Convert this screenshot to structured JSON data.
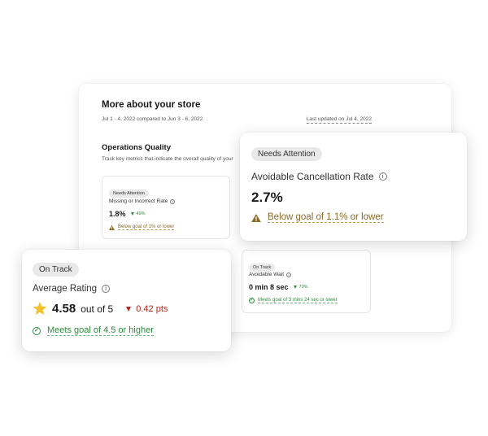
{
  "store": {
    "title": "More about your store",
    "date_range": "Jul 1 - 4, 2022 compared to Jun 3 - 6, 2022",
    "last_updated": "Last updated on Jul 4, 2022"
  },
  "operations": {
    "title": "Operations Quality",
    "description": "Track key metrics that indicate the overall quality of your"
  },
  "metrics": {
    "missing_incorrect": {
      "status": "Needs Attention",
      "label": "Missing or Incorrect Rate",
      "value": "1.8%",
      "delta": "49%",
      "goal": "Below goal of 1% or lower"
    },
    "avoidable_wait": {
      "status": "On Track",
      "label": "Avoidable Wait",
      "value": "0 min 8 sec",
      "delta": "70%",
      "goal": "Meets goal of 3 mins 24 sec or lower"
    },
    "cancellation": {
      "status": "Needs Attention",
      "label": "Avoidable Cancellation Rate",
      "value": "2.7%",
      "goal": "Below goal of 1.1% or lower"
    },
    "rating": {
      "status": "On Track",
      "label": "Average Rating",
      "value": "4.58",
      "suffix": "out of 5",
      "delta": "0.42 pts",
      "goal": "Meets goal of 4.5 or higher"
    }
  },
  "colors": {
    "warning": "#8a6a28",
    "success": "#2f8a3d",
    "negative": "#b5241a",
    "star": "#f2c12e"
  },
  "icons": {
    "info": "i",
    "check": "✓",
    "warning": "warning-triangle-icon",
    "star": "star-icon"
  }
}
